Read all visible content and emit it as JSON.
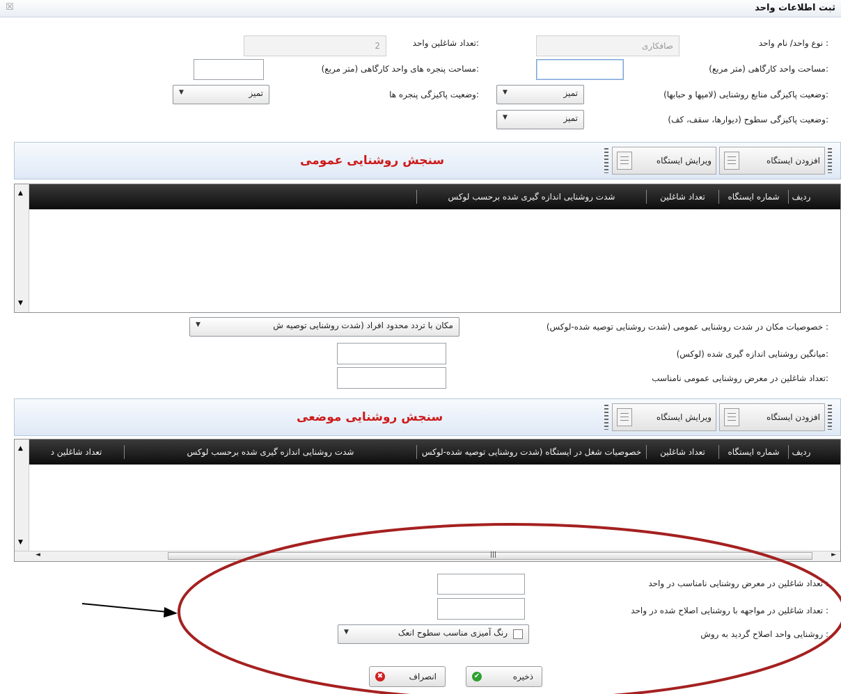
{
  "window": {
    "title": "ثبت اطلاعات واحد",
    "close_glyph": "☒"
  },
  "form": {
    "unit_type_label": "نوع واحد/ نام واحد :",
    "unit_type_value": "صافکاری",
    "workers_label": "تعداد شاغلین واحد:",
    "workers_value": "2",
    "area_label": "مساحت واحد کارگاهی (متر مربع):",
    "area_value": "",
    "window_area_label": "مساحت پنجره های واحد کارگاهی (متر مربع):",
    "window_area_value": "",
    "light_clean_label": "وضعیت پاکیزگی منابع روشنایی (لامپها و حبابها):",
    "light_clean_value": "تمیز",
    "window_clean_label": "وضعیت پاکیزگی پنجره ها:",
    "window_clean_value": "تمیز",
    "surface_clean_label": "وضعیت پاکیزگی سطوح (دیوارها، سقف، کف):",
    "surface_clean_value": "تمیز"
  },
  "general": {
    "title": "سنجش روشنایی عمومی",
    "add_station": "افزودن ایستگاه",
    "edit_station": "ویرایش ایستگاه",
    "columns": [
      "ردیف",
      "شماره ایستگاه",
      "تعداد شاغلین",
      "شدت روشنایی اندازه گیری شده برحسب لوکس"
    ],
    "place_spec_label": "خصوصیات مکان در شدت روشنایی عمومی (شدت روشنایی توصیه شده-لوکس) :",
    "place_spec_value": "مکان با تردد محدود افراد (شدت روشنایی توصیه ش",
    "avg_label": "میانگین روشنایی اندازه گیری شده (لوکس):",
    "avg_value": "",
    "exposed_label": "تعداد شاغلین در معرض روشنایی عمومی نامناسب:",
    "exposed_value": ""
  },
  "local": {
    "title": "سنجش روشنایی موضعی",
    "add_station": "افزودن ایستگاه",
    "edit_station": "ویرایش ایستگاه",
    "columns": [
      "ردیف",
      "شماره ایستگاه",
      "تعداد شاغلین",
      "خصوصیات شغل در ایستگاه (شدت روشنایی توصیه شده-لوکس",
      "شدت روشنایی اندازه گیری شده برحسب لوکس",
      "تعداد شاغلین د"
    ]
  },
  "summary": {
    "unsuitable_label": "تعداد شاغلین  در معرض روشنایی نامناسب در واحد :",
    "unsuitable_value": "",
    "corrected_label": "تعداد شاغلین در مواجهه با روشنایی اصلاح شده در واحد :",
    "corrected_value": "",
    "method_label": "روشنایی واحد اصلاح گردید به روش :",
    "method_value": "رنگ آمیزی مناسب سطوح انعک"
  },
  "buttons": {
    "save": "ذخیره",
    "cancel": "انصراف"
  },
  "icons": {
    "arrow_down": "▼",
    "arrow_up": "▲",
    "arrow_left": "◄",
    "arrow_right": "►",
    "thumb": "|||",
    "check": "✔",
    "cross": "✖"
  },
  "colors": {
    "accent_red": "#cc1a1a",
    "annotation_red": "#a52020",
    "save_green": "#2fa02f",
    "cancel_red": "#d02020"
  }
}
